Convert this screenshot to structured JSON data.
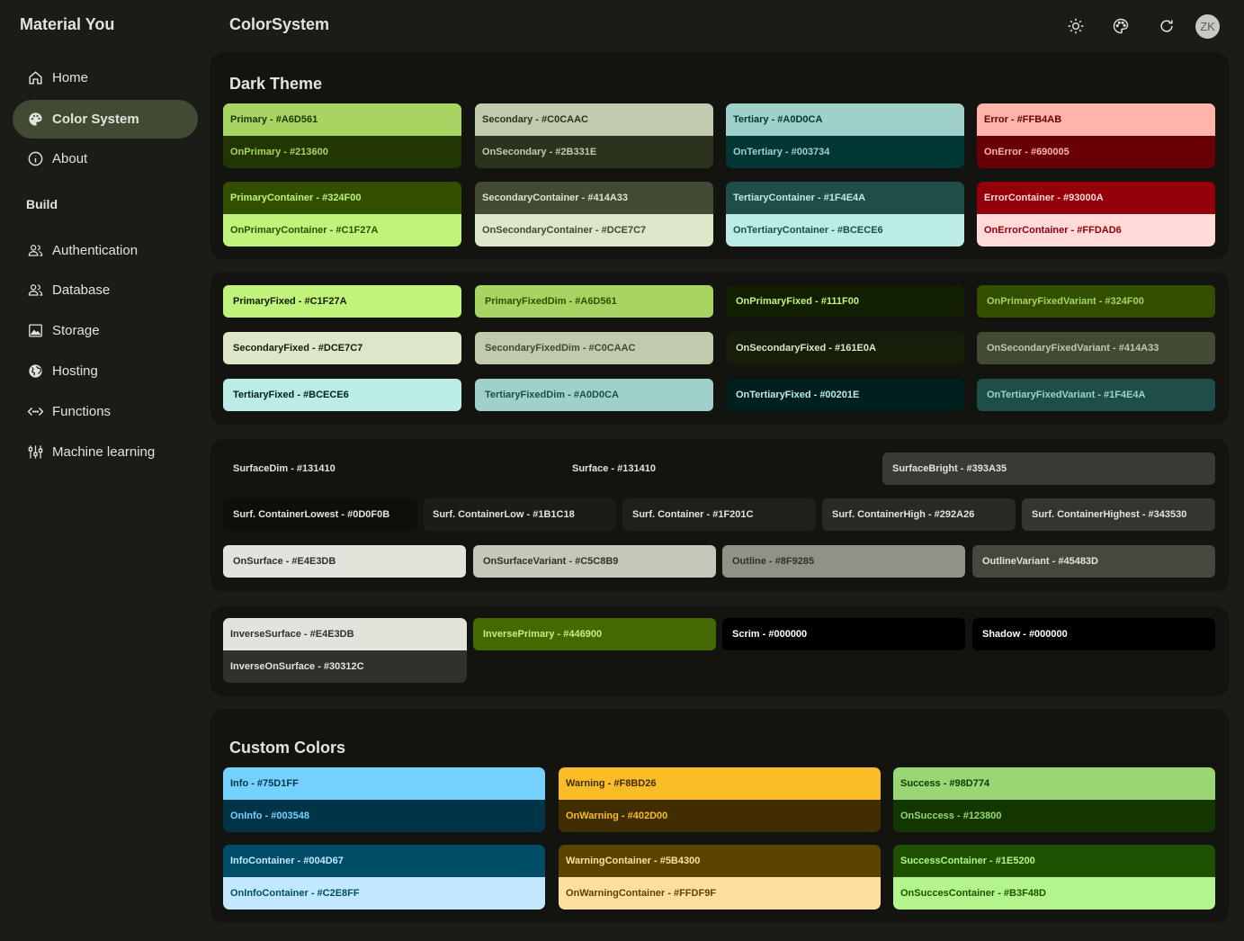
{
  "app": {
    "brand": "Material You",
    "page_title": "ColorSystem",
    "avatar_initials": "ZK"
  },
  "sidebar": {
    "items": [
      {
        "label": "Home",
        "icon": "home-icon"
      },
      {
        "label": "Color System",
        "icon": "palette-icon",
        "active": true
      },
      {
        "label": "About",
        "icon": "info-icon"
      }
    ],
    "build_label": "Build",
    "build_items": [
      {
        "label": "Authentication",
        "icon": "people-icon"
      },
      {
        "label": "Database",
        "icon": "people-icon"
      },
      {
        "label": "Storage",
        "icon": "image-icon"
      },
      {
        "label": "Hosting",
        "icon": "globe-icon"
      },
      {
        "label": "Functions",
        "icon": "code-icon"
      },
      {
        "label": "Machine learning",
        "icon": "tune-icon"
      }
    ]
  },
  "header": {
    "icons": [
      "sun-icon",
      "palette-icon",
      "refresh-icon"
    ]
  },
  "dark_theme": {
    "title": "Dark Theme",
    "main_pairs": [
      {
        "top": "Primary - #A6D561",
        "bot": "OnPrimary - #213600",
        "top_bg": "#A6D561",
        "top_fg": "#213600",
        "bot_bg": "#213600",
        "bot_fg": "#A6D561"
      },
      {
        "top": "Secondary - #C0CAAC",
        "bot": "OnSecondary - #2B331E",
        "top_bg": "#C0CAAC",
        "top_fg": "#2B331E",
        "bot_bg": "#2B331E",
        "bot_fg": "#C0CAAC"
      },
      {
        "top": "Tertiary - #A0D0CA",
        "bot": "OnTertiary - #003734",
        "top_bg": "#A0D0CA",
        "top_fg": "#003734",
        "bot_bg": "#003734",
        "bot_fg": "#A0D0CA"
      },
      {
        "top": "Error - #FFB4AB",
        "bot": "OnError - #690005",
        "top_bg": "#FFB4AB",
        "top_fg": "#690005",
        "bot_bg": "#690005",
        "bot_fg": "#FFB4AB"
      }
    ],
    "container_pairs": [
      {
        "top": "PrimaryContainer - #324F00",
        "bot": "OnPrimaryContainer - #C1F27A",
        "top_bg": "#324F00",
        "top_fg": "#C1F27A",
        "bot_bg": "#C1F27A",
        "bot_fg": "#324F00"
      },
      {
        "top": "SecondaryContainer - #414A33",
        "bot": "OnSecondaryContainer - #DCE7C7",
        "top_bg": "#414A33",
        "top_fg": "#DCE7C7",
        "bot_bg": "#DCE7C7",
        "bot_fg": "#414A33"
      },
      {
        "top": "TertiaryContainer - #1F4E4A",
        "bot": "OnTertiaryContainer - #BCECE6",
        "top_bg": "#1F4E4A",
        "top_fg": "#BCECE6",
        "bot_bg": "#BCECE6",
        "bot_fg": "#1F4E4A"
      },
      {
        "top": "ErrorContainer - #93000A",
        "bot": "OnErrorContainer - #FFDAD6",
        "top_bg": "#93000A",
        "top_fg": "#FFDAD6",
        "bot_bg": "#FFDAD6",
        "bot_fg": "#93000A"
      }
    ]
  },
  "fixed": [
    [
      {
        "label": "PrimaryFixed - #C1F27A",
        "bg": "#C1F27A",
        "fg": "#111F00"
      },
      {
        "label": "PrimaryFixedDim - #A6D561",
        "bg": "#A6D561",
        "fg": "#324F00"
      },
      {
        "label": "OnPrimaryFixed - #111F00",
        "bg": "#111F00",
        "fg": "#C1F27A"
      },
      {
        "label": "OnPrimaryFixedVariant - #324F00",
        "bg": "#324F00",
        "fg": "#A6D561"
      }
    ],
    [
      {
        "label": "SecondaryFixed - #DCE7C7",
        "bg": "#DCE7C7",
        "fg": "#161E0A"
      },
      {
        "label": "SecondaryFixedDim - #C0CAAC",
        "bg": "#C0CAAC",
        "fg": "#414A33"
      },
      {
        "label": "OnSecondaryFixed - #161E0A",
        "bg": "#161E0A",
        "fg": "#DCE7C7"
      },
      {
        "label": "OnSecondaryFixedVariant - #414A33",
        "bg": "#414A33",
        "fg": "#C0CAAC"
      }
    ],
    [
      {
        "label": "TertiaryFixed - #BCECE6",
        "bg": "#BCECE6",
        "fg": "#00201E"
      },
      {
        "label": "TertiaryFixedDim - #A0D0CA",
        "bg": "#A0D0CA",
        "fg": "#1F4E4A"
      },
      {
        "label": "OnTertiaryFixed - #00201E",
        "bg": "#00201E",
        "fg": "#BCECE6"
      },
      {
        "label": "OnTertiaryFixedVariant - #1F4E4A",
        "bg": "#1F4E4A",
        "fg": "#A0D0CA"
      }
    ]
  ],
  "surfaces": {
    "row1": [
      {
        "label": "SurfaceDim - #131410",
        "bg": "#131410",
        "fg": "#E4E3DB"
      },
      {
        "label": "Surface - #131410",
        "bg": "#131410",
        "fg": "#E4E3DB"
      },
      {
        "label": "SurfaceBright - #393A35",
        "bg": "#393A35",
        "fg": "#E4E3DB"
      }
    ],
    "row2": [
      {
        "label": "Surf. ContainerLowest - #0D0F0B",
        "bg": "#0D0F0B",
        "fg": "#E4E3DB"
      },
      {
        "label": "Surf. ContainerLow - #1B1C18",
        "bg": "#1B1C18",
        "fg": "#E4E3DB"
      },
      {
        "label": "Surf. Container - #1F201C",
        "bg": "#1F201C",
        "fg": "#E4E3DB"
      },
      {
        "label": "Surf. ContainerHigh - #292A26",
        "bg": "#292A26",
        "fg": "#E4E3DB"
      },
      {
        "label": "Surf. ContainerHighest - #343530",
        "bg": "#343530",
        "fg": "#E4E3DB"
      }
    ],
    "row3": [
      {
        "label": "OnSurface - #E4E3DB",
        "bg": "#E4E3DB",
        "fg": "#30312C"
      },
      {
        "label": "OnSurfaceVariant - #C5C8B9",
        "bg": "#C5C8B9",
        "fg": "#30312C"
      },
      {
        "label": "Outline - #8F9285",
        "bg": "#8F9285",
        "fg": "#30312C"
      },
      {
        "label": "OutlineVariant - #45483D",
        "bg": "#45483D",
        "fg": "#E4E3DB"
      }
    ]
  },
  "inverse": {
    "pair": {
      "top": "InverseSurface - #E4E3DB",
      "bot": "InverseOnSurface - #30312C",
      "top_bg": "#E4E3DB",
      "top_fg": "#30312C",
      "bot_bg": "#30312C",
      "bot_fg": "#E4E3DB"
    },
    "tiles": [
      {
        "label": "InversePrimary - #446900",
        "bg": "#446900",
        "fg": "#C1F27A"
      },
      {
        "label": "Scrim - #000000",
        "bg": "#000000",
        "fg": "#FFFFFF"
      },
      {
        "label": "Shadow - #000000",
        "bg": "#000000",
        "fg": "#FFFFFF"
      }
    ]
  },
  "custom": {
    "title": "Custom Colors",
    "main_pairs": [
      {
        "top": "Info - #75D1FF",
        "bot": "OnInfo - #003548",
        "top_bg": "#75D1FF",
        "top_fg": "#003548",
        "bot_bg": "#003548",
        "bot_fg": "#75D1FF"
      },
      {
        "top": "Warning - #F8BD26",
        "bot": "OnWarning - #402D00",
        "top_bg": "#F8BD26",
        "top_fg": "#402D00",
        "bot_bg": "#402D00",
        "bot_fg": "#F8BD26"
      },
      {
        "top": "Success - #98D774",
        "bot": "OnSuccess - #123800",
        "top_bg": "#98D774",
        "top_fg": "#123800",
        "bot_bg": "#123800",
        "bot_fg": "#98D774"
      }
    ],
    "container_pairs": [
      {
        "top": "InfoContainer - #004D67",
        "bot": "OnInfoContainer - #C2E8FF",
        "top_bg": "#004D67",
        "top_fg": "#C2E8FF",
        "bot_bg": "#C2E8FF",
        "bot_fg": "#004D67"
      },
      {
        "top": "WarningContainer - #5B4300",
        "bot": "OnWarningContainer - #FFDF9F",
        "top_bg": "#5B4300",
        "top_fg": "#FFDF9F",
        "bot_bg": "#FFDF9F",
        "bot_fg": "#5B4300"
      },
      {
        "top": "SuccessContainer - #1E5200",
        "bot": "OnSuccesContainer - #B3F48D",
        "top_bg": "#1E5200",
        "top_fg": "#B3F48D",
        "bot_bg": "#B3F48D",
        "bot_fg": "#1E5200"
      }
    ]
  }
}
